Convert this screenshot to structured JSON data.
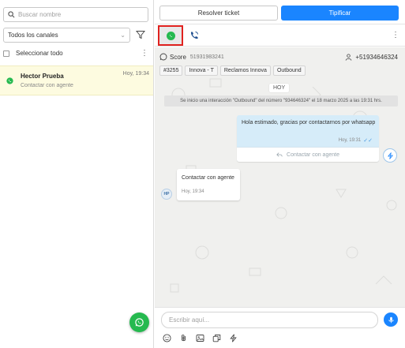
{
  "sidebar": {
    "search_placeholder": "Buscar nombre",
    "channel_filter": "Todos los canales",
    "select_all_label": "Seleccionar todo",
    "conversations": [
      {
        "name": "Hector Prueba",
        "preview": "Contactar con agente",
        "time": "Hoy, 19:34",
        "channel": "whatsapp"
      }
    ]
  },
  "header": {
    "resolve_label": "Resolver ticket",
    "tipificar_label": "Tipificar"
  },
  "contact": {
    "score_label": "Score",
    "score_number": "51931983241",
    "phone": "+51934646324",
    "tags": [
      "#3255",
      "Innova - T",
      "Reclamos Innova",
      "Outbound"
    ]
  },
  "chat": {
    "day_label": "HOY",
    "system_message": "Se inicio una interacción \"Outbound\" del número \"934646324\" el 18 marzo 2025 a las 19:31 hrs.",
    "messages": [
      {
        "direction": "out",
        "text": "Hola estimado, gracias por contactarnos por whatsapp",
        "time": "Hoy, 19:31",
        "button_label": "Contactar con agente"
      },
      {
        "direction": "in",
        "avatar": "HP",
        "text": "Contactar con agente",
        "time": "Hoy, 19:34"
      }
    ]
  },
  "composer": {
    "placeholder": "Escribir aquí..."
  },
  "colors": {
    "primary": "#1a85ff",
    "whatsapp": "#25b94f",
    "highlight": "#e0221f",
    "selected_row": "#fdfbe0"
  }
}
